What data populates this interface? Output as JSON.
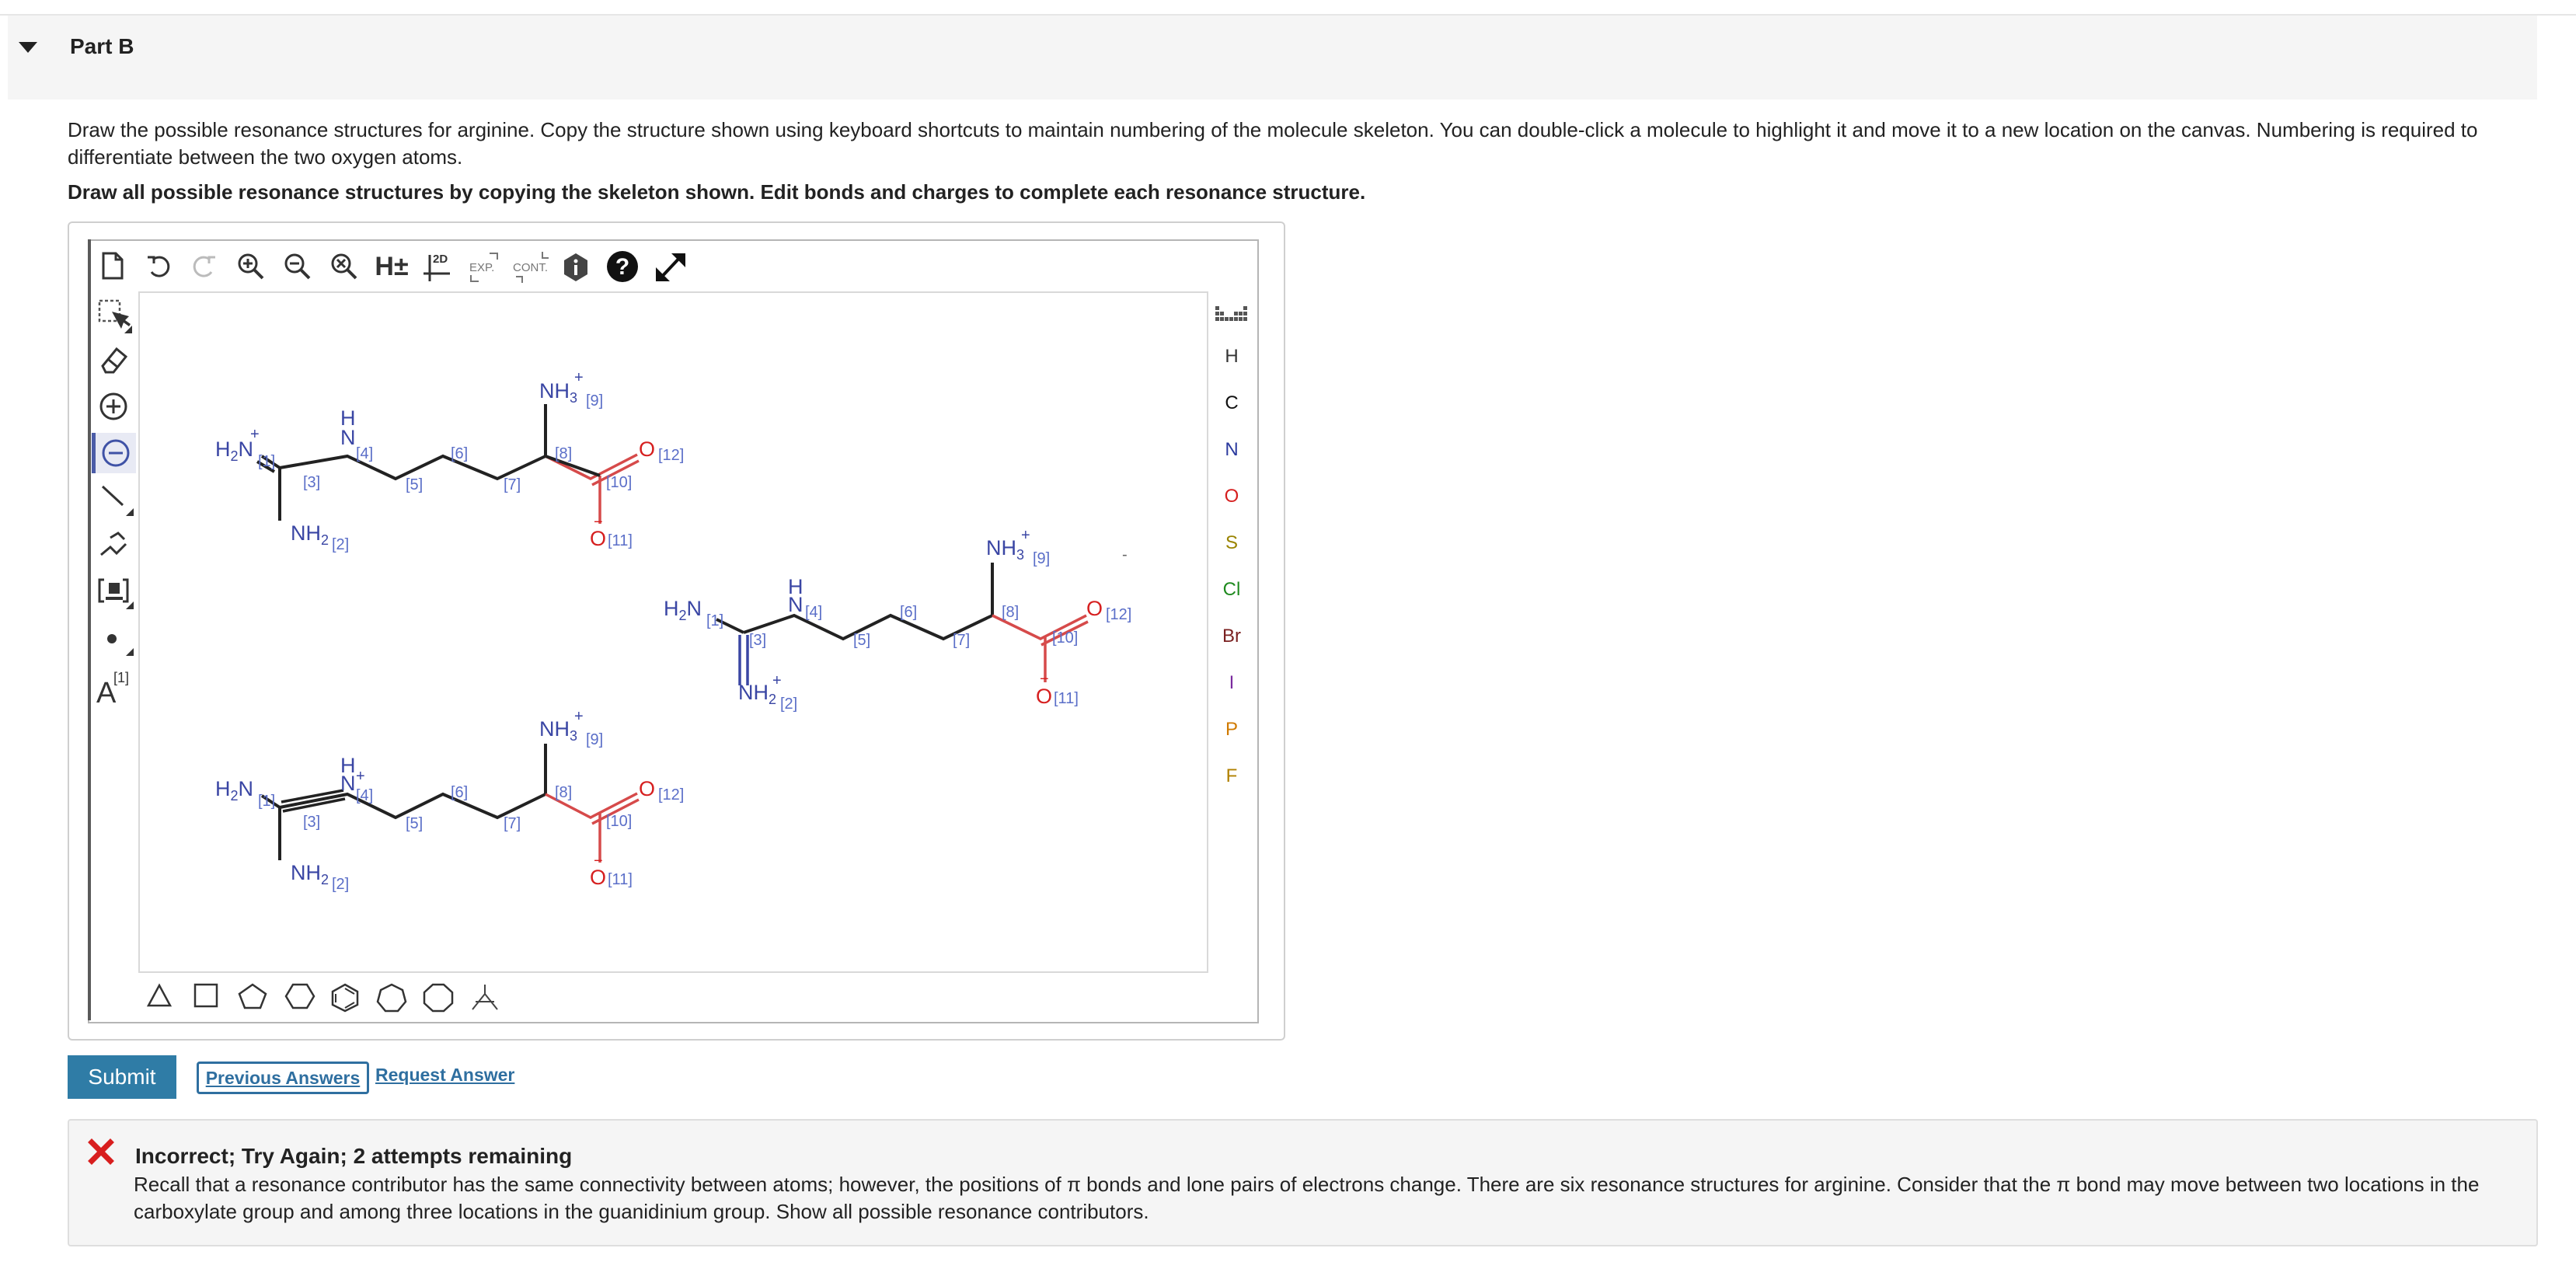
{
  "part": {
    "title": "Part B"
  },
  "instructions": {
    "text": "Draw the possible resonance structures for arginine. Copy the structure shown using keyboard shortcuts to maintain numbering of the molecule skeleton. You can double-click a molecule to highlight it and move it to a new location on the canvas. Numbering is required to differentiate between the two oxygen atoms.",
    "bold": "Draw all possible resonance structures by copying the skeleton shown. Edit bonds and charges to complete each resonance structure."
  },
  "toolbar": {
    "h_label": "H±",
    "twod_label": "2D",
    "exp_label": "EXP.",
    "cont_label": "CONT."
  },
  "lefttools": {
    "atom_label": "A",
    "atom_index": "[1]"
  },
  "elements": [
    {
      "symbol": "H",
      "color": "#333333"
    },
    {
      "symbol": "C",
      "color": "#111111"
    },
    {
      "symbol": "N",
      "color": "#2b3a9e"
    },
    {
      "symbol": "O",
      "color": "#d61f1f"
    },
    {
      "symbol": "S",
      "color": "#9a8400"
    },
    {
      "symbol": "Cl",
      "color": "#1f8a1f"
    },
    {
      "symbol": "Br",
      "color": "#7a2020"
    },
    {
      "symbol": "I",
      "color": "#7a2a9e"
    },
    {
      "symbol": "P",
      "color": "#d07a00"
    },
    {
      "symbol": "F",
      "color": "#b08000"
    }
  ],
  "molecule": {
    "nh3": "NH",
    "nh3_sub": "3",
    "nh2": "NH",
    "nh2_sub": "2",
    "h2n_pre": "H",
    "h2n_sub": "2",
    "h2n_post": "N",
    "n": "N",
    "h": "H",
    "o": "O",
    "plus": "+",
    "minus": "−",
    "labels": {
      "l1": "[1]",
      "l2": "[2]",
      "l3": "[3]",
      "l4": "[4]",
      "l5": "[5]",
      "l6": "[6]",
      "l7": "[7]",
      "l8": "[8]",
      "l9": "[9]",
      "l10": "[10]",
      "l11": "[11]",
      "l12": "[12]"
    }
  },
  "actions": {
    "submit": "Submit",
    "previous": "Previous Answers",
    "request": "Request Answer"
  },
  "feedback": {
    "title": "Incorrect; Try Again; 2 attempts remaining",
    "text": "Recall that a resonance contributor has the same connectivity between atoms; however, the positions of π bonds and lone pairs of electrons change. There are six resonance structures for arginine. Consider that the π bond may move between two locations in the carboxylate group and among three locations in the guanidinium group. Show all possible resonance contributors."
  },
  "colors": {
    "accent": "#2f7ca6",
    "link": "#2f6fa0",
    "error": "#d81e1e",
    "nitrogen": "#2b3a9e",
    "oxygen": "#d61f1f",
    "index": "#5a6ec8"
  }
}
